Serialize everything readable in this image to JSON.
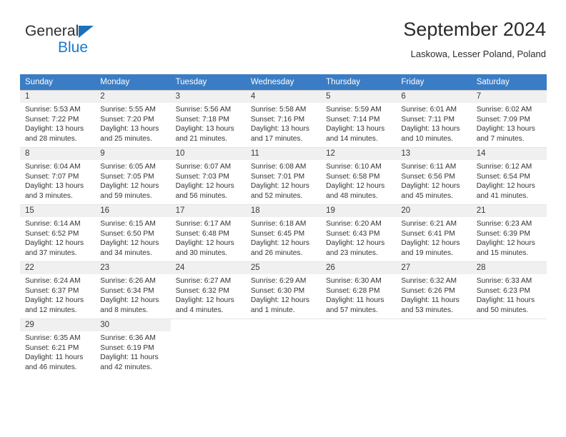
{
  "brand": {
    "name_top": "General",
    "name_bottom": "Blue",
    "triangle_color": "#1b72bb"
  },
  "header": {
    "title": "September 2024",
    "subtitle": "Laskowa, Lesser Poland, Poland"
  },
  "theme": {
    "header_row_bg": "#3b7dc4",
    "header_row_text": "#ffffff",
    "daynum_bg": "#f0f0f0",
    "body_text": "#333333"
  },
  "weekday_headers": [
    "Sunday",
    "Monday",
    "Tuesday",
    "Wednesday",
    "Thursday",
    "Friday",
    "Saturday"
  ],
  "weeks": [
    [
      {
        "day": "1",
        "sunrise": "Sunrise: 5:53 AM",
        "sunset": "Sunset: 7:22 PM",
        "daylight_1": "Daylight: 13 hours",
        "daylight_2": "and 28 minutes."
      },
      {
        "day": "2",
        "sunrise": "Sunrise: 5:55 AM",
        "sunset": "Sunset: 7:20 PM",
        "daylight_1": "Daylight: 13 hours",
        "daylight_2": "and 25 minutes."
      },
      {
        "day": "3",
        "sunrise": "Sunrise: 5:56 AM",
        "sunset": "Sunset: 7:18 PM",
        "daylight_1": "Daylight: 13 hours",
        "daylight_2": "and 21 minutes."
      },
      {
        "day": "4",
        "sunrise": "Sunrise: 5:58 AM",
        "sunset": "Sunset: 7:16 PM",
        "daylight_1": "Daylight: 13 hours",
        "daylight_2": "and 17 minutes."
      },
      {
        "day": "5",
        "sunrise": "Sunrise: 5:59 AM",
        "sunset": "Sunset: 7:14 PM",
        "daylight_1": "Daylight: 13 hours",
        "daylight_2": "and 14 minutes."
      },
      {
        "day": "6",
        "sunrise": "Sunrise: 6:01 AM",
        "sunset": "Sunset: 7:11 PM",
        "daylight_1": "Daylight: 13 hours",
        "daylight_2": "and 10 minutes."
      },
      {
        "day": "7",
        "sunrise": "Sunrise: 6:02 AM",
        "sunset": "Sunset: 7:09 PM",
        "daylight_1": "Daylight: 13 hours",
        "daylight_2": "and 7 minutes."
      }
    ],
    [
      {
        "day": "8",
        "sunrise": "Sunrise: 6:04 AM",
        "sunset": "Sunset: 7:07 PM",
        "daylight_1": "Daylight: 13 hours",
        "daylight_2": "and 3 minutes."
      },
      {
        "day": "9",
        "sunrise": "Sunrise: 6:05 AM",
        "sunset": "Sunset: 7:05 PM",
        "daylight_1": "Daylight: 12 hours",
        "daylight_2": "and 59 minutes."
      },
      {
        "day": "10",
        "sunrise": "Sunrise: 6:07 AM",
        "sunset": "Sunset: 7:03 PM",
        "daylight_1": "Daylight: 12 hours",
        "daylight_2": "and 56 minutes."
      },
      {
        "day": "11",
        "sunrise": "Sunrise: 6:08 AM",
        "sunset": "Sunset: 7:01 PM",
        "daylight_1": "Daylight: 12 hours",
        "daylight_2": "and 52 minutes."
      },
      {
        "day": "12",
        "sunrise": "Sunrise: 6:10 AM",
        "sunset": "Sunset: 6:58 PM",
        "daylight_1": "Daylight: 12 hours",
        "daylight_2": "and 48 minutes."
      },
      {
        "day": "13",
        "sunrise": "Sunrise: 6:11 AM",
        "sunset": "Sunset: 6:56 PM",
        "daylight_1": "Daylight: 12 hours",
        "daylight_2": "and 45 minutes."
      },
      {
        "day": "14",
        "sunrise": "Sunrise: 6:12 AM",
        "sunset": "Sunset: 6:54 PM",
        "daylight_1": "Daylight: 12 hours",
        "daylight_2": "and 41 minutes."
      }
    ],
    [
      {
        "day": "15",
        "sunrise": "Sunrise: 6:14 AM",
        "sunset": "Sunset: 6:52 PM",
        "daylight_1": "Daylight: 12 hours",
        "daylight_2": "and 37 minutes."
      },
      {
        "day": "16",
        "sunrise": "Sunrise: 6:15 AM",
        "sunset": "Sunset: 6:50 PM",
        "daylight_1": "Daylight: 12 hours",
        "daylight_2": "and 34 minutes."
      },
      {
        "day": "17",
        "sunrise": "Sunrise: 6:17 AM",
        "sunset": "Sunset: 6:48 PM",
        "daylight_1": "Daylight: 12 hours",
        "daylight_2": "and 30 minutes."
      },
      {
        "day": "18",
        "sunrise": "Sunrise: 6:18 AM",
        "sunset": "Sunset: 6:45 PM",
        "daylight_1": "Daylight: 12 hours",
        "daylight_2": "and 26 minutes."
      },
      {
        "day": "19",
        "sunrise": "Sunrise: 6:20 AM",
        "sunset": "Sunset: 6:43 PM",
        "daylight_1": "Daylight: 12 hours",
        "daylight_2": "and 23 minutes."
      },
      {
        "day": "20",
        "sunrise": "Sunrise: 6:21 AM",
        "sunset": "Sunset: 6:41 PM",
        "daylight_1": "Daylight: 12 hours",
        "daylight_2": "and 19 minutes."
      },
      {
        "day": "21",
        "sunrise": "Sunrise: 6:23 AM",
        "sunset": "Sunset: 6:39 PM",
        "daylight_1": "Daylight: 12 hours",
        "daylight_2": "and 15 minutes."
      }
    ],
    [
      {
        "day": "22",
        "sunrise": "Sunrise: 6:24 AM",
        "sunset": "Sunset: 6:37 PM",
        "daylight_1": "Daylight: 12 hours",
        "daylight_2": "and 12 minutes."
      },
      {
        "day": "23",
        "sunrise": "Sunrise: 6:26 AM",
        "sunset": "Sunset: 6:34 PM",
        "daylight_1": "Daylight: 12 hours",
        "daylight_2": "and 8 minutes."
      },
      {
        "day": "24",
        "sunrise": "Sunrise: 6:27 AM",
        "sunset": "Sunset: 6:32 PM",
        "daylight_1": "Daylight: 12 hours",
        "daylight_2": "and 4 minutes."
      },
      {
        "day": "25",
        "sunrise": "Sunrise: 6:29 AM",
        "sunset": "Sunset: 6:30 PM",
        "daylight_1": "Daylight: 12 hours",
        "daylight_2": "and 1 minute."
      },
      {
        "day": "26",
        "sunrise": "Sunrise: 6:30 AM",
        "sunset": "Sunset: 6:28 PM",
        "daylight_1": "Daylight: 11 hours",
        "daylight_2": "and 57 minutes."
      },
      {
        "day": "27",
        "sunrise": "Sunrise: 6:32 AM",
        "sunset": "Sunset: 6:26 PM",
        "daylight_1": "Daylight: 11 hours",
        "daylight_2": "and 53 minutes."
      },
      {
        "day": "28",
        "sunrise": "Sunrise: 6:33 AM",
        "sunset": "Sunset: 6:23 PM",
        "daylight_1": "Daylight: 11 hours",
        "daylight_2": "and 50 minutes."
      }
    ],
    [
      {
        "day": "29",
        "sunrise": "Sunrise: 6:35 AM",
        "sunset": "Sunset: 6:21 PM",
        "daylight_1": "Daylight: 11 hours",
        "daylight_2": "and 46 minutes."
      },
      {
        "day": "30",
        "sunrise": "Sunrise: 6:36 AM",
        "sunset": "Sunset: 6:19 PM",
        "daylight_1": "Daylight: 11 hours",
        "daylight_2": "and 42 minutes."
      },
      {
        "day": "",
        "sunrise": "",
        "sunset": "",
        "daylight_1": "",
        "daylight_2": ""
      },
      {
        "day": "",
        "sunrise": "",
        "sunset": "",
        "daylight_1": "",
        "daylight_2": ""
      },
      {
        "day": "",
        "sunrise": "",
        "sunset": "",
        "daylight_1": "",
        "daylight_2": ""
      },
      {
        "day": "",
        "sunrise": "",
        "sunset": "",
        "daylight_1": "",
        "daylight_2": ""
      },
      {
        "day": "",
        "sunrise": "",
        "sunset": "",
        "daylight_1": "",
        "daylight_2": ""
      }
    ]
  ]
}
